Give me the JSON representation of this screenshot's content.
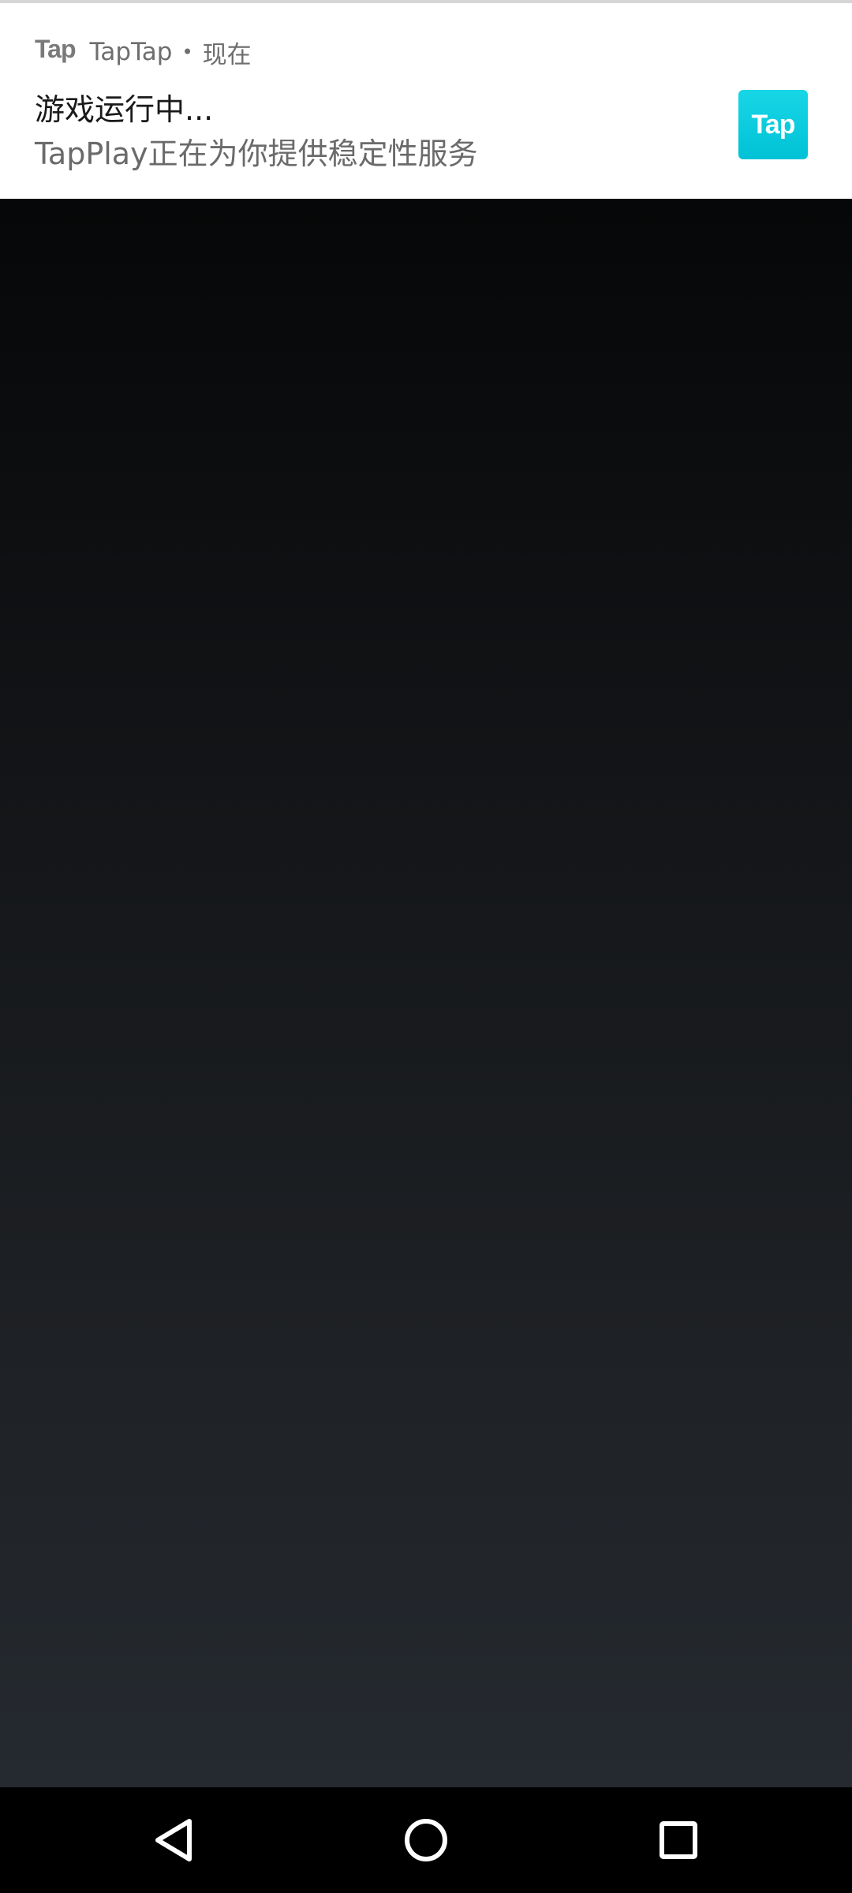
{
  "notification": {
    "app_name": "TapTap",
    "separator": "•",
    "time": "现在",
    "title": "游戏运行中...",
    "body": "TapPlay正在为你提供稳定性服务",
    "small_icon_text": "Tap",
    "large_icon_text": "Tap",
    "accent_color": "#00C8DC"
  },
  "navigation": {
    "back": "back-icon",
    "home": "home-icon",
    "recents": "recents-icon"
  }
}
